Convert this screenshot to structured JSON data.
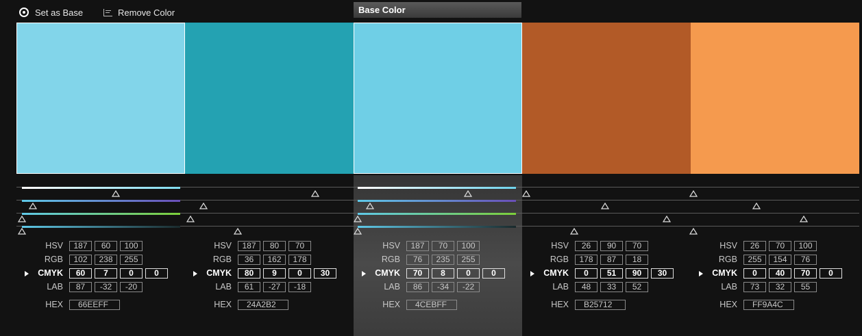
{
  "toolbar": {
    "set_base_label": "Set as Base",
    "remove_color_label": "Remove Color",
    "base_color_tab": "Base Color"
  },
  "columns": [
    {
      "color": "#82D5EA",
      "hsv": [
        "187",
        "60",
        "100"
      ],
      "rgb": [
        "102",
        "238",
        "255"
      ],
      "cmyk": [
        "60",
        "7",
        "0",
        "0"
      ],
      "lab": [
        "87",
        "-32",
        "-20"
      ],
      "hex": "66EEFF",
      "selected": true
    },
    {
      "color": "#24A2B2",
      "hsv": [
        "187",
        "80",
        "70"
      ],
      "rgb": [
        "36",
        "162",
        "178"
      ],
      "cmyk": [
        "80",
        "9",
        "0",
        "30"
      ],
      "lab": [
        "61",
        "-27",
        "-18"
      ],
      "hex": "24A2B2",
      "selected": false
    },
    {
      "color": "#6FCFE6",
      "hsv": [
        "187",
        "70",
        "100"
      ],
      "rgb": [
        "76",
        "235",
        "255"
      ],
      "cmyk": [
        "70",
        "8",
        "0",
        "0"
      ],
      "lab": [
        "86",
        "-34",
        "-22"
      ],
      "hex": "4CEBFF",
      "selected": true
    },
    {
      "color": "#B25A27",
      "hsv": [
        "26",
        "90",
        "70"
      ],
      "rgb": [
        "178",
        "87",
        "18"
      ],
      "cmyk": [
        "0",
        "51",
        "90",
        "30"
      ],
      "lab": [
        "48",
        "33",
        "52"
      ],
      "hex": "B25712",
      "selected": false
    },
    {
      "color": "#F59A4E",
      "hsv": [
        "26",
        "70",
        "100"
      ],
      "rgb": [
        "255",
        "154",
        "76"
      ],
      "cmyk": [
        "0",
        "40",
        "70",
        "0"
      ],
      "lab": [
        "73",
        "32",
        "55"
      ],
      "hex": "FF9A4C",
      "selected": false
    }
  ],
  "labels": {
    "hsv": "HSV",
    "rgb": "RGB",
    "cmyk": "CMYK",
    "lab": "LAB",
    "hex": "HEX"
  }
}
